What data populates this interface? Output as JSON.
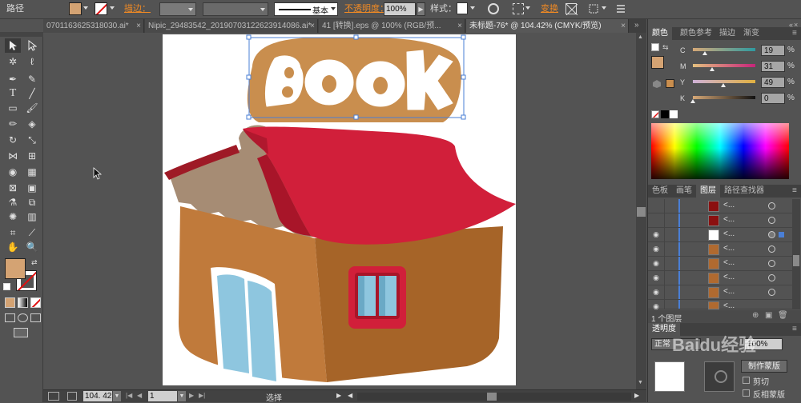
{
  "control_bar": {
    "object_type": "路径",
    "fill_color": "#d4a373",
    "stroke_label": "描边：",
    "stroke_style_label": "基本",
    "opacity_label": "不透明度：",
    "opacity_value": "100%",
    "style_label": "样式：",
    "transform_label": "变换"
  },
  "tabs": [
    {
      "label": "0701163625318030.ai*",
      "active": false
    },
    {
      "label": "Nipic_29483542_20190703122623914086.ai*",
      "active": false
    },
    {
      "label": "41 [转换].eps @ 100% (RGB/预...",
      "active": false
    },
    {
      "label": "未标题-76* @ 104.42% (CMYK/预览)",
      "active": true
    }
  ],
  "artwork": {
    "sign_text": "Book",
    "sign_color": "#c98e4e",
    "roof_color": "#d11f3a",
    "wall_color": "#b86f30",
    "wall_side_color": "#c07a3b",
    "thatch_color": "#a68c74",
    "window_glass": "#8ec6df"
  },
  "status_bar": {
    "zoom": "104. 42",
    "page": "1",
    "tool": "选择"
  },
  "color_panel": {
    "tabs": [
      "颜色",
      "颜色参考",
      "描边",
      "渐变"
    ],
    "active_tab": "颜色",
    "channels": [
      {
        "label": "C",
        "value": "19",
        "unit": "%",
        "level": 0.19
      },
      {
        "label": "M",
        "value": "31",
        "unit": "%",
        "level": 0.31
      },
      {
        "label": "Y",
        "value": "49",
        "unit": "%",
        "level": 0.49
      },
      {
        "label": "K",
        "value": "0",
        "unit": "%",
        "level": 0.0
      }
    ]
  },
  "layers_panel": {
    "tabs": [
      "色板",
      "画笔",
      "图层",
      "路径查找器"
    ],
    "active_tab": "图层",
    "rows": [
      {
        "name": "<...",
        "thumb": "#8b1010"
      },
      {
        "name": "<...",
        "thumb": "#8b1010"
      },
      {
        "name": "<...",
        "thumb": "#ffffff"
      },
      {
        "name": "<...",
        "thumb": "#b06a30"
      },
      {
        "name": "<...",
        "thumb": "#b06a30"
      },
      {
        "name": "<...",
        "thumb": "#b06a30"
      },
      {
        "name": "<...",
        "thumb": "#b06a30"
      },
      {
        "name": "<...",
        "thumb": "#b06a30"
      }
    ],
    "layer_count": "1 个图层"
  },
  "transparency_panel": {
    "title": "透明度",
    "mode": "正常",
    "opacity_value": "100%",
    "make_mask_button": "制作蒙版",
    "clip_label": "剪切",
    "invert_label": "反相蒙版"
  },
  "watermark": "Baidu经验"
}
